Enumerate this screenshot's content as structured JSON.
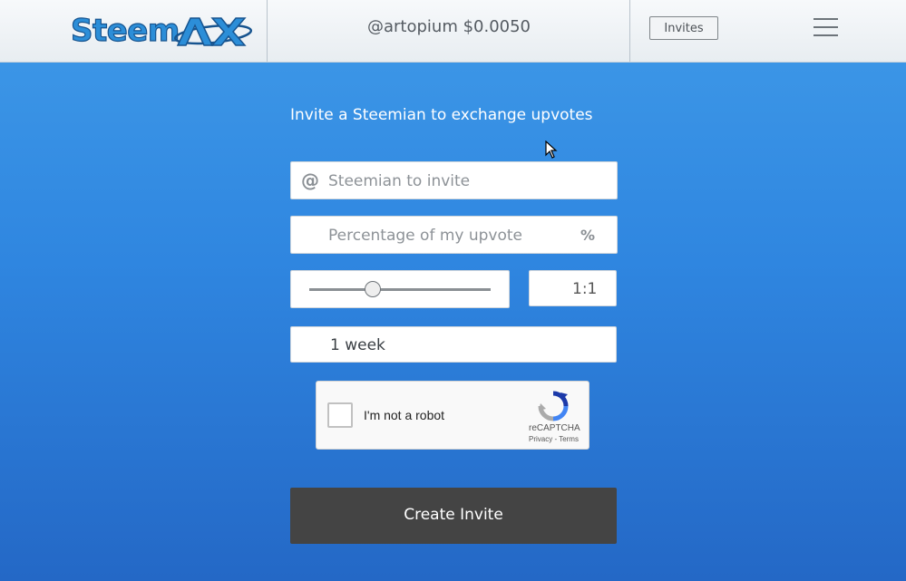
{
  "header": {
    "logo_text": "Steem",
    "user": "@artopium $0.0050",
    "invites_label": "Invites"
  },
  "form": {
    "title": "Invite a Steemian to exchange upvotes",
    "invitee": {
      "icon": "at-icon",
      "icon_glyph": "@",
      "placeholder": "Steemian to invite"
    },
    "percentage": {
      "placeholder": "Percentage of my upvote",
      "suffix": "%"
    },
    "ratio": {
      "value": "1:1",
      "slider_position": 0.35
    },
    "duration": {
      "value": "1 week"
    },
    "submit_label": "Create Invite"
  },
  "recaptcha": {
    "label": "I'm not a robot",
    "brand": "reCAPTCHA",
    "links": "Privacy - Terms"
  },
  "colors": {
    "background_top": "#3f9ae8",
    "background_bottom": "#2468c6",
    "button": "#444444",
    "logo": "#2c8ed8"
  }
}
